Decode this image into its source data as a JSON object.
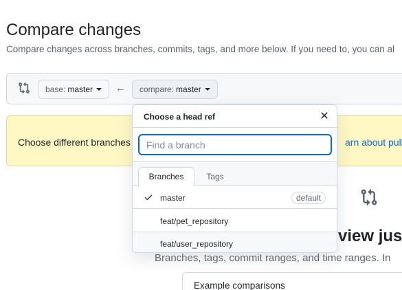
{
  "header": {
    "title": "Compare changes",
    "description": "Compare changes across branches, commits, tags, and more below. If you need to, you can al"
  },
  "range": {
    "base_prefix": "base:",
    "base_value": "master",
    "compare_prefix": "compare:",
    "compare_value": "master",
    "arrow": "←"
  },
  "notice": {
    "text": "Choose different branches",
    "link": "arn about pull r"
  },
  "blankslate": {
    "heading": "view just",
    "subtext": "Branches, tags, commit ranges, and time ranges. In",
    "examples_label": "Example comparisons"
  },
  "dropdown": {
    "title": "Choose a head ref",
    "search_placeholder": "Find a branch",
    "tabs": [
      "Branches",
      "Tags"
    ],
    "items": [
      {
        "label": "master",
        "selected": true,
        "badge": "default"
      },
      {
        "label": "feat/pet_repository",
        "selected": false
      },
      {
        "label": "feat/user_repository",
        "selected": false
      }
    ]
  },
  "colors": {
    "accent": "#0969da",
    "notice_bg": "#fff8c5",
    "border": "#d1d9e0"
  }
}
